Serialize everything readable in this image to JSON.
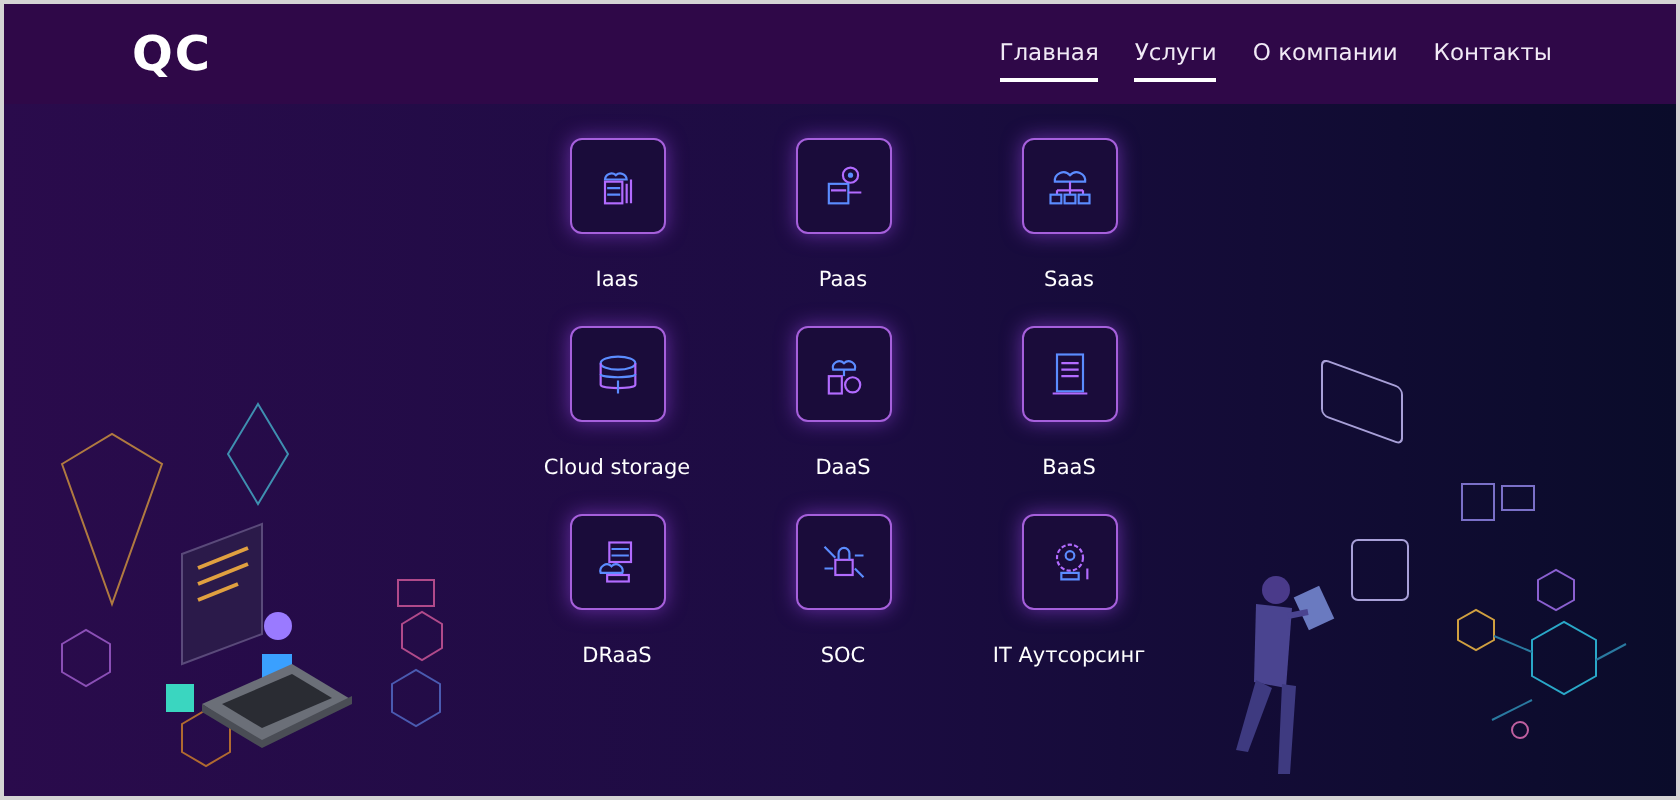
{
  "header": {
    "logo": "QC",
    "nav": [
      {
        "label": "Главная",
        "selected": true
      },
      {
        "label": "Услуги",
        "selected": true
      },
      {
        "label": "О компании",
        "selected": false
      },
      {
        "label": "Контакты",
        "selected": false
      }
    ]
  },
  "services": [
    {
      "label": "Iaas"
    },
    {
      "label": "Paas"
    },
    {
      "label": "Saas"
    },
    {
      "label": "Cloud storage"
    },
    {
      "label": "DaaS"
    },
    {
      "label": "BaaS"
    },
    {
      "label": "DRaaS"
    },
    {
      "label": "SOC"
    },
    {
      "label": "IT Аутсорсинг"
    }
  ]
}
